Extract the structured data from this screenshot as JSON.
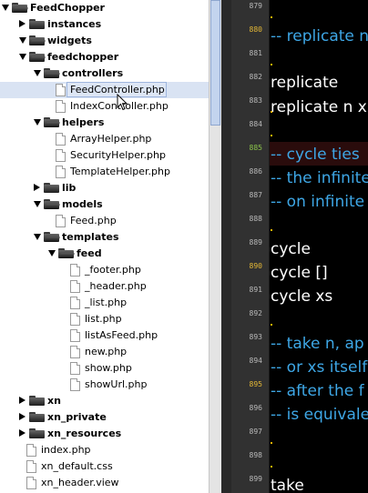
{
  "tree": {
    "items": [
      {
        "label": "FeedChopper",
        "kind": "folder",
        "state": "open"
      },
      {
        "label": "instances",
        "kind": "folder",
        "state": "closed"
      },
      {
        "label": "widgets",
        "kind": "folder",
        "state": "open"
      },
      {
        "label": "feedchopper",
        "kind": "folder",
        "state": "open"
      },
      {
        "label": "controllers",
        "kind": "folder",
        "state": "open"
      },
      {
        "label": "FeedController.php",
        "kind": "file",
        "selected": true
      },
      {
        "label": "IndexController.php",
        "kind": "file"
      },
      {
        "label": "helpers",
        "kind": "folder",
        "state": "open"
      },
      {
        "label": "ArrayHelper.php",
        "kind": "file"
      },
      {
        "label": "SecurityHelper.php",
        "kind": "file"
      },
      {
        "label": "TemplateHelper.php",
        "kind": "file"
      },
      {
        "label": "lib",
        "kind": "folder",
        "state": "closed"
      },
      {
        "label": "models",
        "kind": "folder",
        "state": "open"
      },
      {
        "label": "Feed.php",
        "kind": "file"
      },
      {
        "label": "templates",
        "kind": "folder",
        "state": "open"
      },
      {
        "label": "feed",
        "kind": "folder",
        "state": "open"
      },
      {
        "label": "_footer.php",
        "kind": "file"
      },
      {
        "label": "_header.php",
        "kind": "file"
      },
      {
        "label": "_list.php",
        "kind": "file"
      },
      {
        "label": "list.php",
        "kind": "file"
      },
      {
        "label": "listAsFeed.php",
        "kind": "file"
      },
      {
        "label": "new.php",
        "kind": "file"
      },
      {
        "label": "show.php",
        "kind": "file"
      },
      {
        "label": "showUrl.php",
        "kind": "file"
      },
      {
        "label": "xn",
        "kind": "folder",
        "state": "closed"
      },
      {
        "label": "xn_private",
        "kind": "folder",
        "state": "closed"
      },
      {
        "label": "xn_resources",
        "kind": "folder",
        "state": "closed"
      },
      {
        "label": "index.php",
        "kind": "file"
      },
      {
        "label": "xn_default.css",
        "kind": "file"
      },
      {
        "label": "xn_header.view",
        "kind": "file"
      }
    ]
  },
  "editor": {
    "line_numbers": [
      {
        "n": "879",
        "color": "normal"
      },
      {
        "n": "880",
        "color": "yellow"
      },
      {
        "n": "881",
        "color": "normal"
      },
      {
        "n": "882",
        "color": "normal"
      },
      {
        "n": "883",
        "color": "normal"
      },
      {
        "n": "884",
        "color": "normal"
      },
      {
        "n": "885",
        "color": "green"
      },
      {
        "n": "886",
        "color": "normal"
      },
      {
        "n": "887",
        "color": "normal"
      },
      {
        "n": "888",
        "color": "normal"
      },
      {
        "n": "889",
        "color": "normal"
      },
      {
        "n": "890",
        "color": "yellow"
      },
      {
        "n": "891",
        "color": "normal"
      },
      {
        "n": "892",
        "color": "normal"
      },
      {
        "n": "893",
        "color": "normal"
      },
      {
        "n": "894",
        "color": "normal"
      },
      {
        "n": "895",
        "color": "yellow"
      },
      {
        "n": "896",
        "color": "normal"
      },
      {
        "n": "897",
        "color": "normal"
      },
      {
        "n": "898",
        "color": "normal"
      },
      {
        "n": "899",
        "color": "normal"
      }
    ],
    "code_lines": [
      {
        "text": "-- replicate n",
        "style": "comment"
      },
      {
        "text": "replicate",
        "style": "plain"
      },
      {
        "text": "replicate n x",
        "style": "plain"
      },
      {
        "text": "-- cycle ties",
        "style": "comment"
      },
      {
        "text": "-- the infinite",
        "style": "comment"
      },
      {
        "text": "-- on infinite",
        "style": "comment"
      },
      {
        "text": "cycle",
        "style": "plain"
      },
      {
        "text": "cycle []",
        "style": "plain"
      },
      {
        "text": "cycle xs",
        "style": "plain"
      },
      {
        "text": "-- take n, ap",
        "style": "comment"
      },
      {
        "text": "-- or xs itself",
        "style": "comment"
      },
      {
        "text": "-- after the f",
        "style": "comment"
      },
      {
        "text": "-- is equivalen",
        "style": "comment"
      },
      {
        "text": "take",
        "style": "plain"
      }
    ],
    "colors": {
      "comment": "#3ea7e6",
      "plain": "#ffffff",
      "line_number": "#b9b9b9",
      "line_number_yellow": "#e4b836",
      "line_number_green": "#8bc34a",
      "background": "#000000"
    }
  }
}
